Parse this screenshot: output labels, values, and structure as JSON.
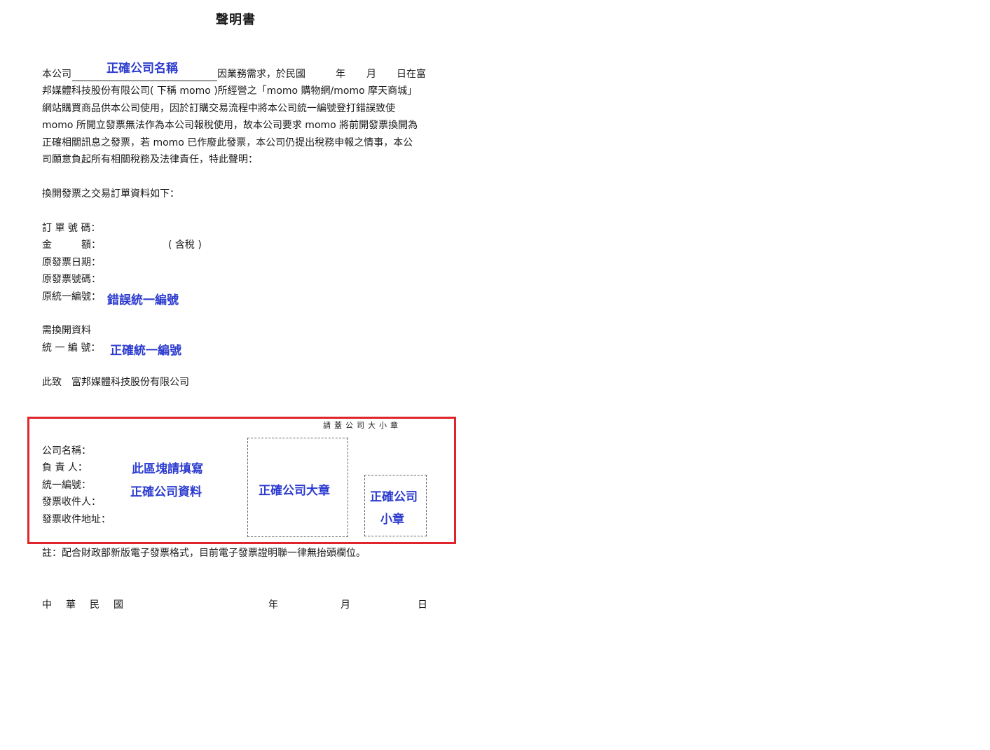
{
  "document": {
    "title": "聲明書",
    "intro": {
      "line1_prefix": "本公司",
      "company_name_fill": "正確公司名稱",
      "line1_suffix": "因業務需求，於民國",
      "year": "年",
      "month": "月",
      "day_suffix": "日在富",
      "line2": "邦媒體科技股份有限公司( 下稱 momo )所經營之「momo 購物網/momo 摩天商城」",
      "line3": "網站購買商品供本公司使用，因於訂購交易流程中將本公司統一編號登打錯誤致使",
      "line4": "momo 所開立發票無法作為本公司報稅使用，故本公司要求 momo 將前開發票換開為",
      "line5": "正確相關訊息之發票，若 momo 已作廢此發票，本公司仍提出稅務申報之情事，本公",
      "line6": "司願意負起所有相關稅務及法律責任，特此聲明："
    },
    "order_intro": "換開發票之交易訂單資料如下：",
    "order_fields": {
      "order_no": "訂 單 號 碼：",
      "amount": "金　　　額：",
      "tax_note": "( 含稅 )",
      "orig_date": "原發票日期：",
      "orig_no": "原發票號碼：",
      "orig_tax_id": "原統一編號：",
      "orig_tax_id_fill": "錯誤統一編號"
    },
    "reissue": {
      "heading": "需換開資料",
      "tax_id_label": "統 一 編 號：",
      "tax_id_fill": "正確統一編號"
    },
    "addressee": "此致　富邦媒體科技股份有限公司",
    "company_block": {
      "stamp_hint": "請蓋公司大小章",
      "labels": {
        "company_name": "公司名稱：",
        "responsible": "負 責 人：",
        "tax_id": "統一編號：",
        "receiver": "發票收件人：",
        "address": "發票收件地址："
      },
      "fill_line1": "此區塊請填寫",
      "fill_line2": "正確公司資料",
      "big_stamp": "正確公司大章",
      "small_stamp_line1": "正確公司",
      "small_stamp_line2": "小章"
    },
    "note": "註：配合財政部新版電子發票格式，目前電子發票證明聯一律無抬頭欄位。",
    "date_line": {
      "era": "中　華　民　國",
      "year": "年",
      "month": "月",
      "day": "日"
    }
  },
  "colors": {
    "fill_text": "#2d3ccf",
    "highlight_border": "#e0252a",
    "body_text": "#1a1a1a"
  }
}
